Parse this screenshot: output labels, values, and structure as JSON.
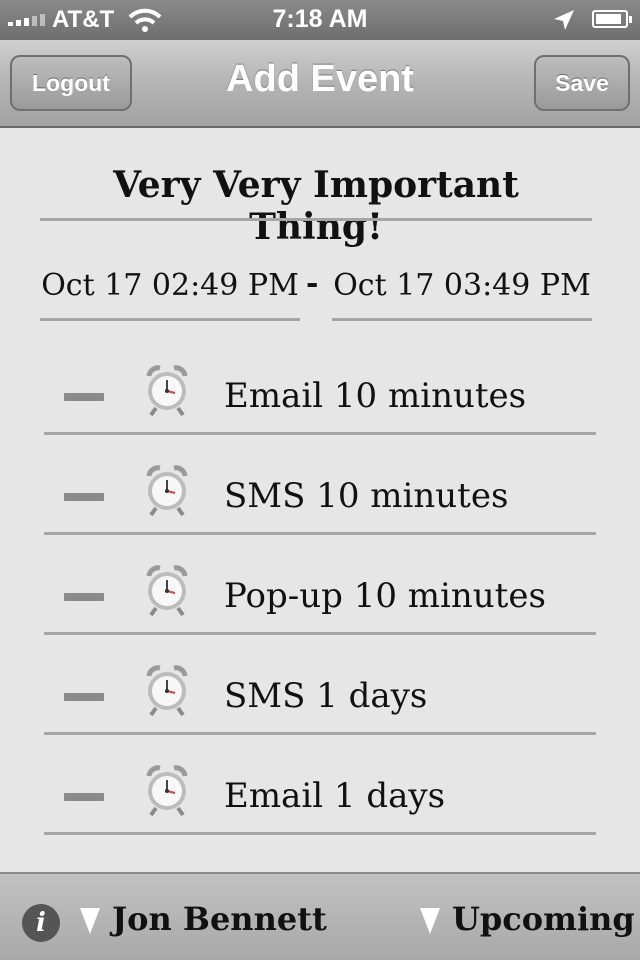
{
  "status_bar": {
    "carrier": "AT&T",
    "time": "7:18 AM",
    "battery_level": 0.9
  },
  "nav": {
    "logout_label": "Logout",
    "title": "Add Event",
    "save_label": "Save"
  },
  "event": {
    "title": "Very Very Important Thing!",
    "start": "Oct 17 02:49 PM",
    "separator": "-",
    "end": "Oct 17 03:49 PM"
  },
  "reminders": [
    {
      "label": "Email 10 minutes"
    },
    {
      "label": "SMS 10 minutes"
    },
    {
      "label": "Pop-up 10 minutes"
    },
    {
      "label": "SMS 1 days"
    },
    {
      "label": "Email 1 days"
    }
  ],
  "bottom_bar": {
    "user_name": "Jon Bennett",
    "filter_label": "Upcoming"
  },
  "icons": {
    "remove": "minus-icon",
    "reminder": "alarm-clock-icon",
    "info": "info-icon",
    "dropdown": "triangle-down-icon"
  }
}
